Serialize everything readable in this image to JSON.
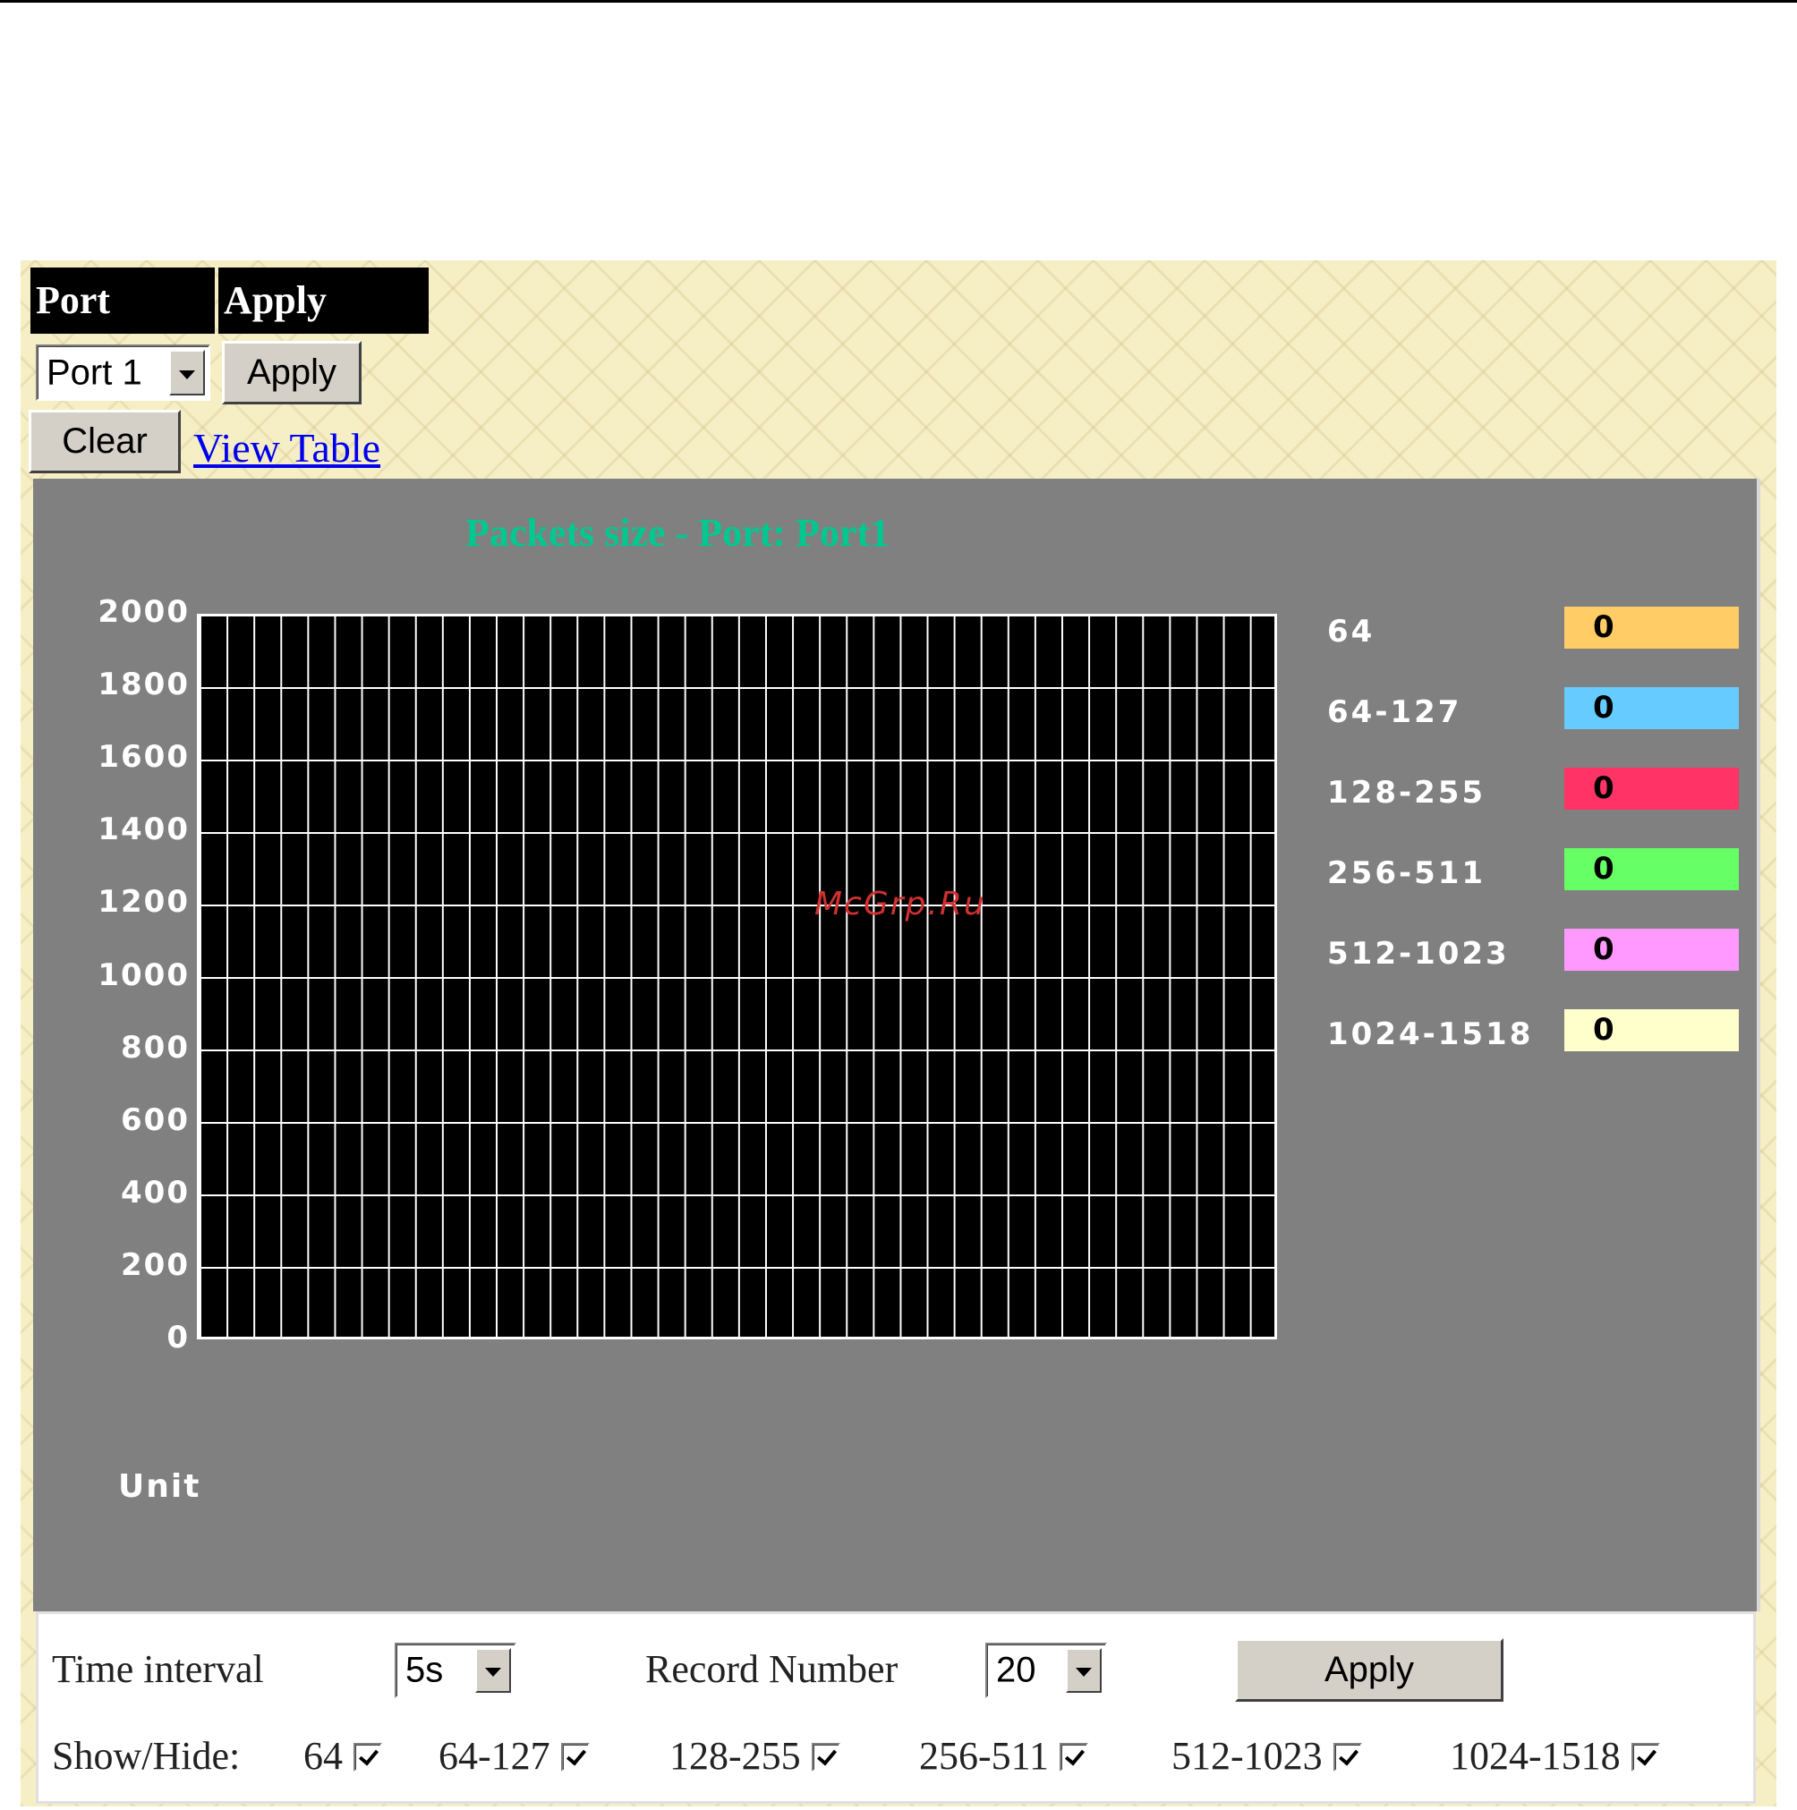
{
  "header": {
    "port_label": "Port",
    "apply_label": "Apply"
  },
  "port_select": {
    "value": "Port 1"
  },
  "buttons": {
    "apply": "Apply",
    "clear": "Clear",
    "bottom_apply": "Apply"
  },
  "links": {
    "view_table": "View Table"
  },
  "chart_data": {
    "type": "line",
    "title": "Packets size - Port: Port1",
    "xlabel": "Unit",
    "ylim": [
      0,
      2000
    ],
    "yticks": [
      "2000",
      "1800",
      "1600",
      "1400",
      "1200",
      "1000",
      "800",
      "600",
      "400",
      "200",
      "0"
    ],
    "series": [
      {
        "name": "64",
        "current": "0",
        "color": "#ffcc66"
      },
      {
        "name": "64-127",
        "current": "0",
        "color": "#66ccff"
      },
      {
        "name": "128-255",
        "current": "0",
        "color": "#ff3366"
      },
      {
        "name": "256-511",
        "current": "0",
        "color": "#66ff66"
      },
      {
        "name": "512-1023",
        "current": "0",
        "color": "#ff99ff"
      },
      {
        "name": "1024-1518",
        "current": "0",
        "color": "#ffffcc"
      }
    ],
    "grid": true,
    "legend_placement": "right"
  },
  "controls": {
    "time_interval_label": "Time interval",
    "time_interval_value": "5s",
    "record_number_label": "Record Number",
    "record_number_value": "20",
    "show_hide_label": "Show/Hide:",
    "checkboxes": [
      {
        "label": "64",
        "checked": true
      },
      {
        "label": "64-127",
        "checked": true
      },
      {
        "label": "128-255",
        "checked": true
      },
      {
        "label": "256-511",
        "checked": true
      },
      {
        "label": "512-1023",
        "checked": true
      },
      {
        "label": "1024-1518",
        "checked": true
      }
    ]
  },
  "watermark": "McGrp.Ru"
}
